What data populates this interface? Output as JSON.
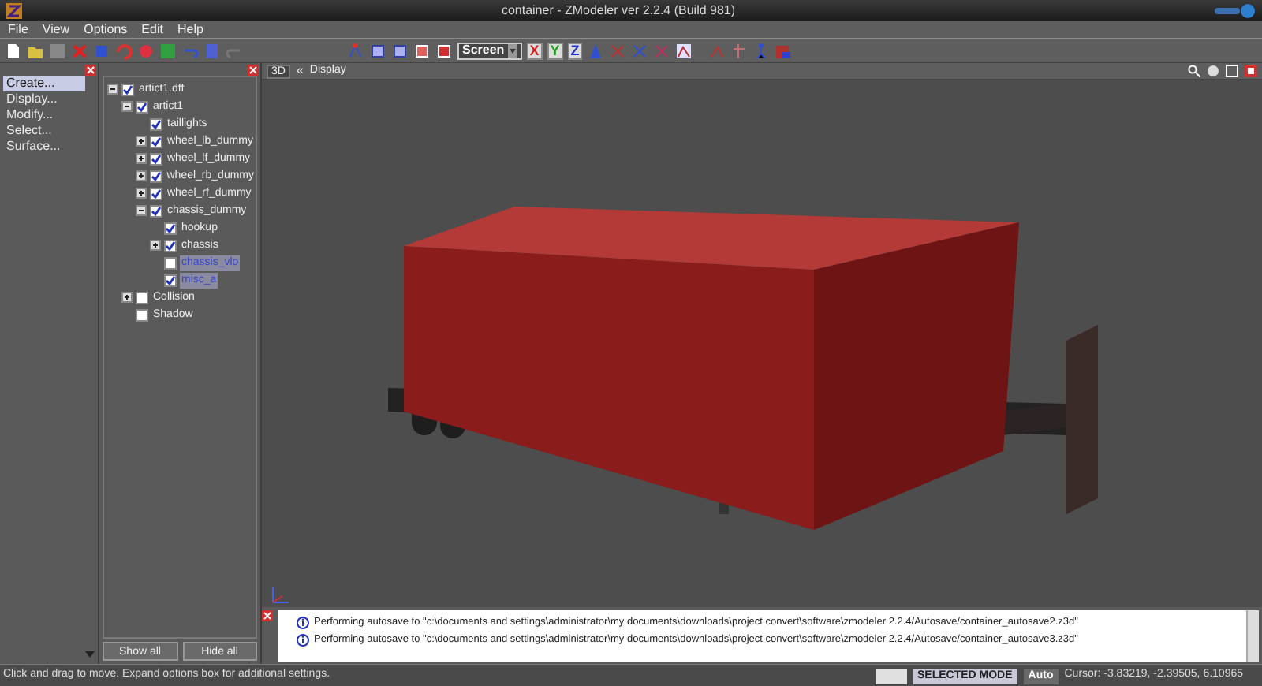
{
  "window": {
    "title": "container - ZModeler ver 2.2.4 (Build 981)"
  },
  "menu": [
    "File",
    "View",
    "Options",
    "Edit",
    "Help"
  ],
  "toolbar": {
    "coordinate_system": "Screen",
    "axes": [
      {
        "label": "X",
        "color": "#d02020"
      },
      {
        "label": "Y",
        "color": "#20a020"
      },
      {
        "label": "Z",
        "color": "#2030d0"
      }
    ]
  },
  "command_panel": {
    "items": [
      {
        "label": "Create...",
        "selected": true
      },
      {
        "label": "Display...",
        "selected": false
      },
      {
        "label": "Modify...",
        "selected": false
      },
      {
        "label": "Select...",
        "selected": false
      },
      {
        "label": "Surface...",
        "selected": false
      }
    ]
  },
  "scene_tree": {
    "nodes": [
      {
        "label": "artict1.dff",
        "checked": true,
        "expanded": true,
        "selected": false,
        "children": [
          {
            "label": "artict1",
            "checked": true,
            "expanded": true,
            "selected": false,
            "children": [
              {
                "label": "taillights",
                "checked": true,
                "selected": false
              },
              {
                "label": "wheel_lb_dummy",
                "checked": true,
                "expanded": false,
                "selected": false
              },
              {
                "label": "wheel_lf_dummy",
                "checked": true,
                "expanded": false,
                "selected": false
              },
              {
                "label": "wheel_rb_dummy",
                "checked": true,
                "expanded": false,
                "selected": false
              },
              {
                "label": "wheel_rf_dummy",
                "checked": true,
                "expanded": false,
                "selected": false
              },
              {
                "label": "chassis_dummy",
                "checked": true,
                "expanded": true,
                "selected": false,
                "children": [
                  {
                    "label": "hookup",
                    "checked": true,
                    "selected": false
                  },
                  {
                    "label": "chassis",
                    "checked": true,
                    "expanded": false,
                    "selected": false
                  },
                  {
                    "label": "chassis_vlo",
                    "checked": false,
                    "selected": true
                  },
                  {
                    "label": "misc_a",
                    "checked": true,
                    "selected": true
                  }
                ]
              }
            ]
          },
          {
            "label": "Collision",
            "checked": false,
            "expanded": false,
            "selected": false
          },
          {
            "label": "Shadow",
            "checked": false,
            "selected": false
          }
        ]
      }
    ],
    "buttons": [
      "Show all",
      "Hide all"
    ]
  },
  "viewport": {
    "view_button": "3D",
    "collapse_button": "«",
    "title": "Display"
  },
  "log": {
    "messages": [
      "Performing autosave to \"c:\\documents and settings\\administrator\\my documents\\downloads\\project convert\\software\\zmodeler 2.2.4/Autosave/container_autosave2.z3d\"",
      "Performing autosave to \"c:\\documents and settings\\administrator\\my documents\\downloads\\project convert\\software\\zmodeler 2.2.4/Autosave/container_autosave3.z3d\""
    ]
  },
  "status_bar": {
    "hint": "Click and drag to move. Expand options box for additional settings.",
    "mode": "SELECTED MODE",
    "snap": "Auto",
    "cursor": "Cursor: -3.83219, -2.39505, 6.10965"
  }
}
